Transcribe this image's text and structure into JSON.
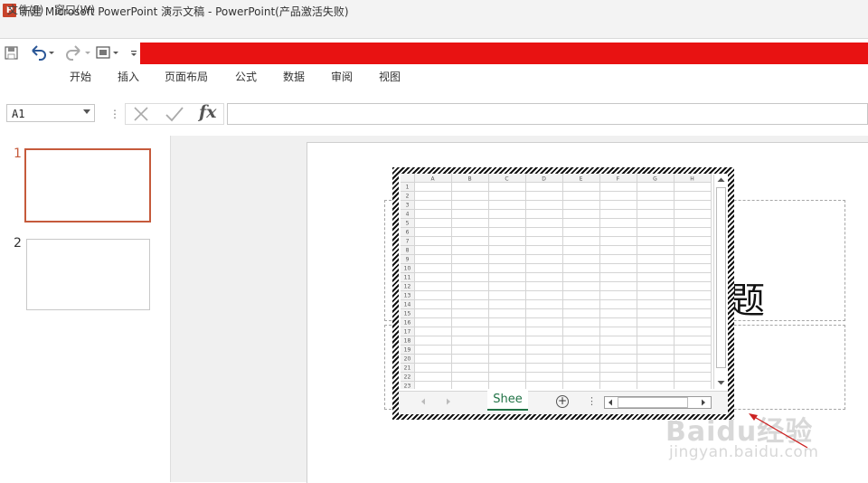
{
  "titlebar": {
    "app_icon": "P",
    "title": "新建 Microsoft PowerPoint 演示文稿 - PowerPoint(产品激活失败)"
  },
  "menubar": {
    "items": [
      "文件(F)",
      "窗口(W)"
    ]
  },
  "qat": {
    "icons": [
      "save-icon",
      "undo-icon",
      "redo-icon",
      "format-icon",
      "customize-icon"
    ]
  },
  "ribbon": {
    "tabs": [
      "开始",
      "插入",
      "页面布局",
      "公式",
      "数据",
      "审阅",
      "视图"
    ]
  },
  "formula_bar": {
    "name_box": "A1",
    "separator": "⋮",
    "fx_label": "fx",
    "formula": ""
  },
  "slides": {
    "items": [
      {
        "number": "1",
        "selected": true
      },
      {
        "number": "2",
        "selected": false
      }
    ]
  },
  "slide_content": {
    "title_fragment": "题"
  },
  "sheet": {
    "columns": [
      "A",
      "B",
      "C",
      "D",
      "E",
      "F",
      "G",
      "H"
    ],
    "rows": [
      "1",
      "2",
      "3",
      "4",
      "5",
      "6",
      "7",
      "8",
      "9",
      "10",
      "11",
      "12",
      "13",
      "14",
      "15",
      "16",
      "17",
      "18",
      "19",
      "20",
      "21",
      "22",
      "23"
    ],
    "tab_label": "Shee",
    "add_label": "+",
    "more_label": "⋮"
  },
  "watermark": {
    "logo": "Baidu经验",
    "url": "jingyan.baidu.com"
  },
  "colors": {
    "accent_red_bar": "#e81212",
    "selected_slide_border": "#c55a3b",
    "sheet_tab_green": "#217346",
    "annotation_arrow": "#cc2222"
  }
}
